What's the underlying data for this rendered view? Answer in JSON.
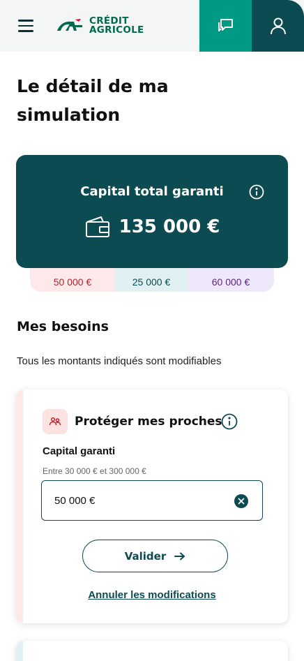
{
  "header": {
    "logo_line1": "CRÉDIT",
    "logo_line2": "AGRICOLE",
    "chat_label": "Contact",
    "account_label": "Mon compte"
  },
  "page": {
    "title": "Le détail de ma simulation"
  },
  "capital": {
    "label": "Capital total garanti",
    "amount": "135 000 €",
    "breakdown": [
      {
        "value": "50 000 €",
        "color": "#b2222e"
      },
      {
        "value": "25 000 €",
        "color": "#0d4b53"
      },
      {
        "value": "60 000 €",
        "color": "#5a2680"
      }
    ]
  },
  "needs": {
    "title": "Mes besoins",
    "subtitle": "Tous les montants indiqués sont modifiables",
    "card": {
      "title": "Protéger mes proches",
      "field_label": "Capital garanti",
      "field_hint": "Entre 30 000 € et 300 000 €",
      "field_value": "50 000 €",
      "validate_label": "Valider",
      "cancel_label": "Annuler les modifications"
    }
  },
  "colors": {
    "primary": "#0d4b53",
    "accent": "#009a84",
    "brand_green": "#006a4e",
    "brand_red": "#e4002b"
  }
}
